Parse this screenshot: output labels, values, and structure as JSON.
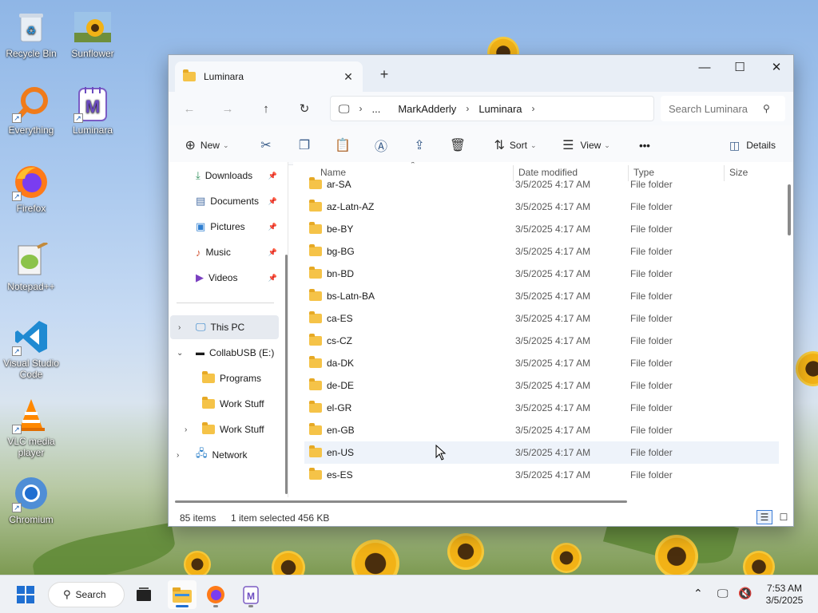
{
  "desktop": {
    "icons": [
      {
        "label": "Recycle Bin",
        "icon": "recycle-bin-icon"
      },
      {
        "label": "Sunflower",
        "icon": "image-icon"
      },
      {
        "label": "Everything",
        "icon": "search-magnifier-icon"
      },
      {
        "label": "Luminara",
        "icon": "luminara-icon"
      },
      {
        "label": "Firefox",
        "icon": "firefox-icon"
      },
      {
        "label": "Notepad++",
        "icon": "notepad-plus-plus-icon"
      },
      {
        "label": "Visual Studio Code",
        "icon": "vscode-icon"
      },
      {
        "label": "VLC media player",
        "icon": "vlc-icon"
      },
      {
        "label": "Chromium",
        "icon": "chromium-icon"
      }
    ]
  },
  "window": {
    "tab_title": "Luminara",
    "breadcrumb": [
      "...",
      "MarkAdderly",
      "Luminara"
    ],
    "search_placeholder": "Search Luminara",
    "toolbar": {
      "new_label": "New",
      "sort_label": "Sort",
      "view_label": "View",
      "more_label": "•••",
      "details_label": "Details"
    },
    "nav": {
      "quick_access": [
        {
          "label": "Downloads",
          "icon": "download-icon"
        },
        {
          "label": "Documents",
          "icon": "documents-icon"
        },
        {
          "label": "Pictures",
          "icon": "pictures-icon"
        },
        {
          "label": "Music",
          "icon": "music-icon"
        },
        {
          "label": "Videos",
          "icon": "videos-icon"
        }
      ],
      "this_pc": "This PC",
      "drive": "CollabUSB (E:)",
      "drive_children": [
        "Programs",
        "Work Stuff",
        "Work Stuff"
      ],
      "network": "Network"
    },
    "columns": {
      "name": "Name",
      "date": "Date modified",
      "type": "Type",
      "size": "Size"
    },
    "files": [
      {
        "name": "ar-SA",
        "date": "3/5/2025 4:17 AM",
        "type": "File folder"
      },
      {
        "name": "az-Latn-AZ",
        "date": "3/5/2025 4:17 AM",
        "type": "File folder"
      },
      {
        "name": "be-BY",
        "date": "3/5/2025 4:17 AM",
        "type": "File folder"
      },
      {
        "name": "bg-BG",
        "date": "3/5/2025 4:17 AM",
        "type": "File folder"
      },
      {
        "name": "bn-BD",
        "date": "3/5/2025 4:17 AM",
        "type": "File folder"
      },
      {
        "name": "bs-Latn-BA",
        "date": "3/5/2025 4:17 AM",
        "type": "File folder"
      },
      {
        "name": "ca-ES",
        "date": "3/5/2025 4:17 AM",
        "type": "File folder"
      },
      {
        "name": "cs-CZ",
        "date": "3/5/2025 4:17 AM",
        "type": "File folder"
      },
      {
        "name": "da-DK",
        "date": "3/5/2025 4:17 AM",
        "type": "File folder"
      },
      {
        "name": "de-DE",
        "date": "3/5/2025 4:17 AM",
        "type": "File folder"
      },
      {
        "name": "el-GR",
        "date": "3/5/2025 4:17 AM",
        "type": "File folder"
      },
      {
        "name": "en-GB",
        "date": "3/5/2025 4:17 AM",
        "type": "File folder"
      },
      {
        "name": "en-US",
        "date": "3/5/2025 4:17 AM",
        "type": "File folder"
      },
      {
        "name": "es-ES",
        "date": "3/5/2025 4:17 AM",
        "type": "File folder"
      }
    ],
    "status": {
      "count": "85 items",
      "selected": "1 item selected",
      "size": "456 KB"
    }
  },
  "taskbar": {
    "search_label": "Search",
    "time": "7:53 AM",
    "date": "3/5/2025"
  }
}
